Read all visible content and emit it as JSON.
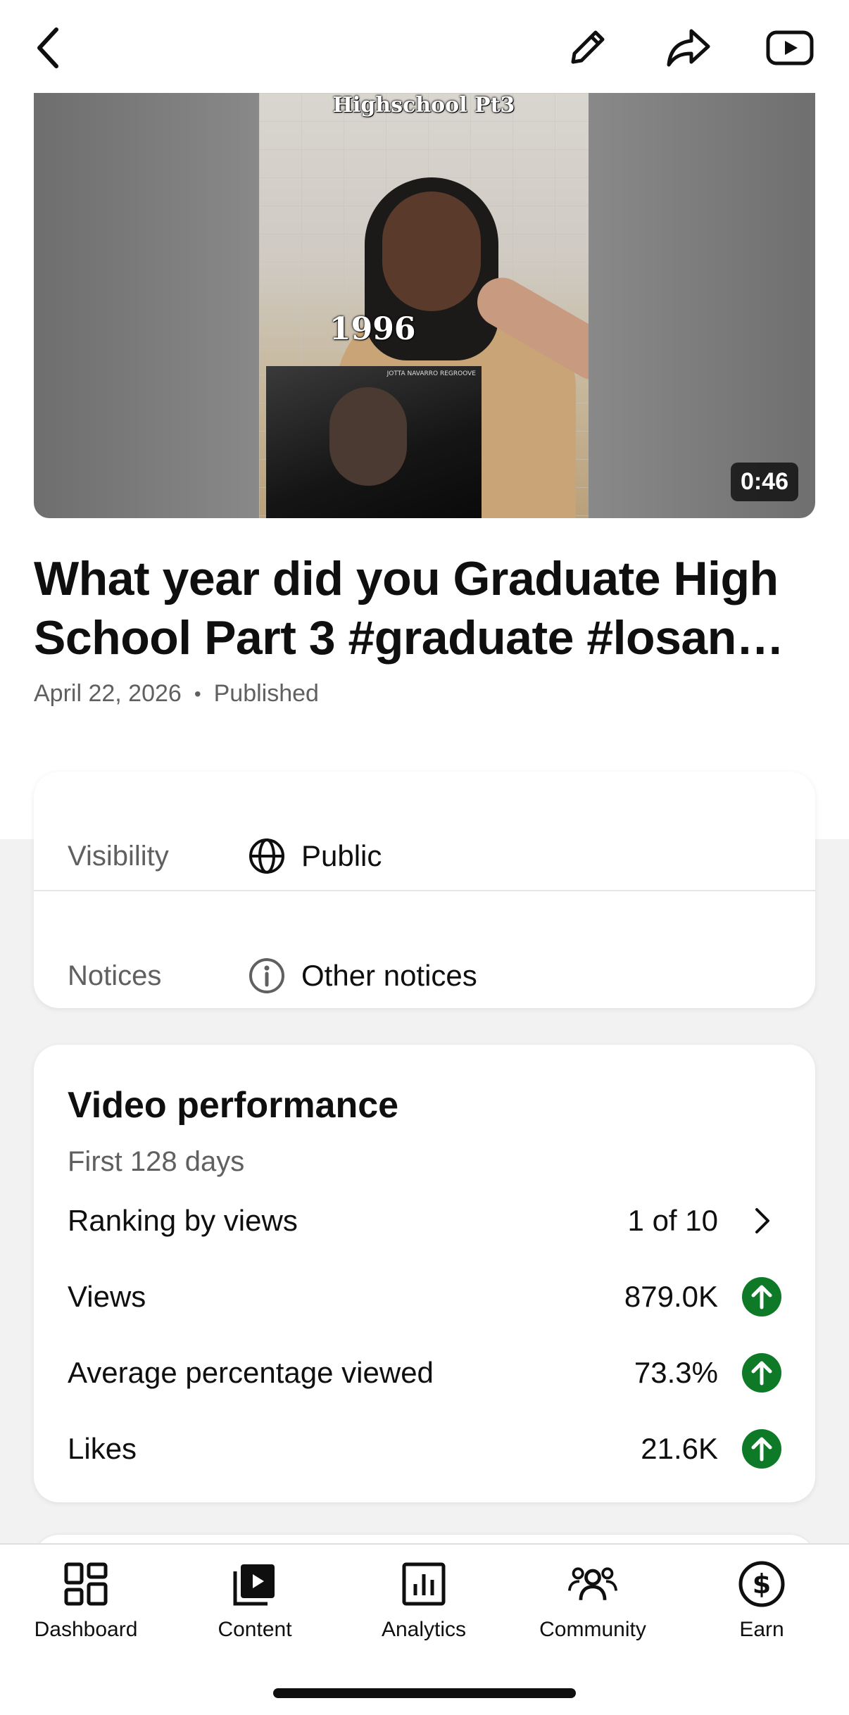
{
  "video": {
    "duration": "0:46",
    "title": "What year did you Graduate High School Part 3 #graduate #losan…",
    "date": "April 22, 2026",
    "separator": "•",
    "status": "Published",
    "thumbnail_caption": "Highschool Pt3",
    "thumbnail_year": "1996",
    "thumbnail_credit": "JOTTA NAVARRO REGROOVE"
  },
  "details": {
    "visibility_label": "Visibility",
    "visibility_value": "Public",
    "notices_label": "Notices",
    "notices_value": "Other notices"
  },
  "performance": {
    "title": "Video performance",
    "period": "First 128 days",
    "rows": [
      {
        "metric": "Ranking by views",
        "value": "1 of 10",
        "indicator": "chevron-right-icon"
      },
      {
        "metric": "Views",
        "value": "879.0K",
        "indicator": "arrow-up-icon"
      },
      {
        "metric": "Average percentage viewed",
        "value": "73.3%",
        "indicator": "arrow-up-icon"
      },
      {
        "metric": "Likes",
        "value": "21.6K",
        "indicator": "arrow-up-icon"
      }
    ]
  },
  "bottom_nav": [
    {
      "label": "Dashboard",
      "icon": "dashboard-icon"
    },
    {
      "label": "Content",
      "icon": "content-icon"
    },
    {
      "label": "Analytics",
      "icon": "analytics-icon"
    },
    {
      "label": "Community",
      "icon": "community-icon"
    },
    {
      "label": "Earn",
      "icon": "earn-icon"
    }
  ],
  "colors": {
    "accent_up": "#0e7a28",
    "text_primary": "#0f0f0f",
    "text_secondary": "#606060"
  }
}
